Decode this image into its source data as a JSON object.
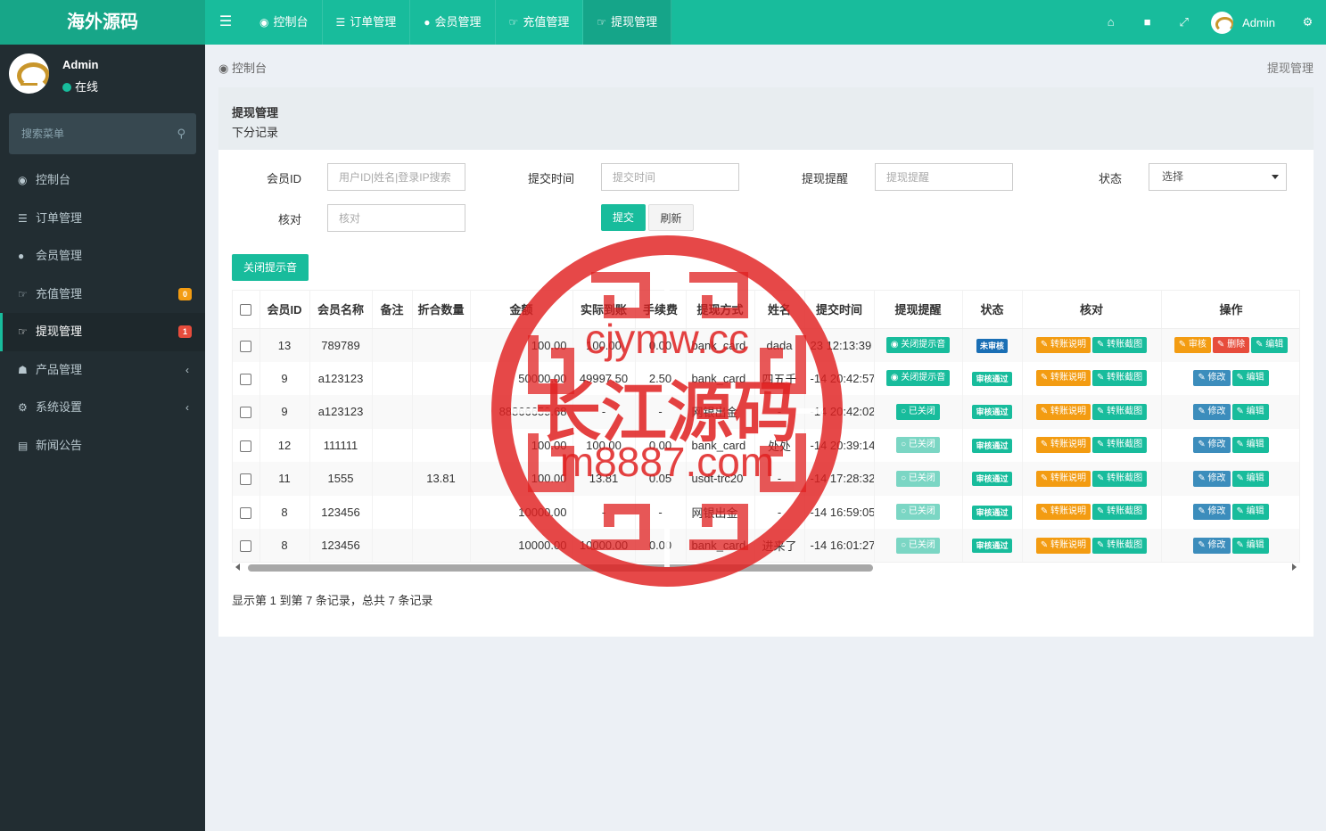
{
  "app": {
    "title": "海外源码"
  },
  "topnav": {
    "tabs": [
      {
        "label": "控制台"
      },
      {
        "label": "订单管理"
      },
      {
        "label": "会员管理"
      },
      {
        "label": "充值管理"
      },
      {
        "label": "提现管理"
      }
    ],
    "user": "Admin"
  },
  "sidebar": {
    "user": {
      "name": "Admin",
      "status": "在线"
    },
    "search_placeholder": "搜索菜单",
    "items": [
      {
        "label": "控制台"
      },
      {
        "label": "订单管理"
      },
      {
        "label": "会员管理"
      },
      {
        "label": "充值管理",
        "badge": "0"
      },
      {
        "label": "提现管理",
        "badge": "1"
      },
      {
        "label": "产品管理"
      },
      {
        "label": "系统设置"
      },
      {
        "label": "新闻公告"
      }
    ]
  },
  "breadcrumb": {
    "home": "控制台",
    "current": "提现管理"
  },
  "panel": {
    "title": "提现管理",
    "subtitle": "下分记录"
  },
  "filters": {
    "member_id": {
      "label": "会员ID",
      "placeholder": "用户ID|姓名|登录IP搜索"
    },
    "submit_time": {
      "label": "提交时间",
      "placeholder": "提交时间"
    },
    "reminder": {
      "label": "提现提醒",
      "placeholder": "提现提醒"
    },
    "status": {
      "label": "状态",
      "value": "选择"
    },
    "verify": {
      "label": "核对",
      "placeholder": "核对"
    },
    "submit_label": "提交",
    "refresh_label": "刷新"
  },
  "toolbar": {
    "close_sound_label": "关闭提示音"
  },
  "table": {
    "headers": [
      "会员ID",
      "会员名称",
      "备注",
      "折合数量",
      "金额",
      "实际到账",
      "手续费",
      "提现方式",
      "姓名",
      "提交时间",
      "提现提醒",
      "状态",
      "核对",
      "操作"
    ],
    "rows": [
      {
        "id": "13",
        "name": "789789",
        "note": "",
        "converted": "",
        "amount": "100.00",
        "actual": "100.00",
        "fee": "0.00",
        "method": "bank_card",
        "realname": "dada",
        "time": "23 12:13:39",
        "reminder": "关闭提示音",
        "reminder_style": "on",
        "status": "未审核",
        "status_style": "pending",
        "verify": [
          "转账说明",
          "转账截图"
        ],
        "ops": [
          "审核",
          "删除",
          "编辑"
        ]
      },
      {
        "id": "9",
        "name": "a123123",
        "note": "",
        "converted": "",
        "amount": "50000.00",
        "actual": "49997.50",
        "fee": "2.50",
        "method": "bank_card",
        "realname": "四五千",
        "time": "-14 20:42:57",
        "reminder": "关闭提示音",
        "reminder_style": "on",
        "status": "审核通过",
        "status_style": "ok",
        "verify": [
          "转账说明",
          "转账截图"
        ],
        "ops": [
          "修改",
          "编辑"
        ]
      },
      {
        "id": "9",
        "name": "a123123",
        "note": "",
        "converted": "",
        "amount": "88866659.68",
        "actual": "-",
        "fee": "-",
        "method": "网银出金",
        "realname": "-",
        "time": "-14 20:42:02",
        "reminder": "已关闭",
        "reminder_style": "off",
        "status": "审核通过",
        "status_style": "ok",
        "verify": [
          "转账说明",
          "转账截图"
        ],
        "ops": [
          "修改",
          "编辑"
        ]
      },
      {
        "id": "12",
        "name": "111111",
        "note": "",
        "converted": "",
        "amount": "100.00",
        "actual": "100.00",
        "fee": "0.00",
        "method": "bank_card",
        "realname": "处处",
        "time": "-14 20:39:14",
        "reminder": "已关闭",
        "reminder_style": "off-light",
        "status": "审核通过",
        "status_style": "ok",
        "verify": [
          "转账说明",
          "转账截图"
        ],
        "ops": [
          "修改",
          "编辑"
        ]
      },
      {
        "id": "11",
        "name": "1555",
        "note": "",
        "converted": "13.81",
        "amount": "100.00",
        "actual": "13.81",
        "fee": "0.05",
        "method": "usdt-trc20",
        "realname": "-",
        "time": "-14 17:28:32",
        "reminder": "已关闭",
        "reminder_style": "off-light",
        "status": "审核通过",
        "status_style": "ok",
        "verify": [
          "转账说明",
          "转账截图"
        ],
        "ops": [
          "修改",
          "编辑"
        ]
      },
      {
        "id": "8",
        "name": "123456",
        "note": "",
        "converted": "",
        "amount": "10000.00",
        "actual": "-",
        "fee": "-",
        "method": "网银出金",
        "realname": "-",
        "time": "-14 16:59:05",
        "reminder": "已关闭",
        "reminder_style": "off-light",
        "status": "审核通过",
        "status_style": "ok",
        "verify": [
          "转账说明",
          "转账截图"
        ],
        "ops": [
          "修改",
          "编辑"
        ]
      },
      {
        "id": "8",
        "name": "123456",
        "note": "",
        "converted": "",
        "amount": "10000.00",
        "actual": "10000.00",
        "fee": "0.00",
        "method": "bank_card",
        "realname": "进来了",
        "time": "-14 16:01:27",
        "reminder": "已关闭",
        "reminder_style": "off-light",
        "status": "审核通过",
        "status_style": "ok",
        "verify": [
          "转账说明",
          "转账截图"
        ],
        "ops": [
          "修改",
          "编辑"
        ]
      }
    ]
  },
  "summary": "显示第 1 到第 7 条记录，总共 7 条记录",
  "watermark": {
    "line1": "cjymw.cc",
    "line2": "长江源码",
    "line3": "m8887.com"
  },
  "colors": {
    "primary": "#18bc9c",
    "sidebar": "#222d32",
    "warning": "#f39c12",
    "danger": "#e74c3c",
    "info": "#3c8dbc",
    "stamp": "#e02020"
  }
}
